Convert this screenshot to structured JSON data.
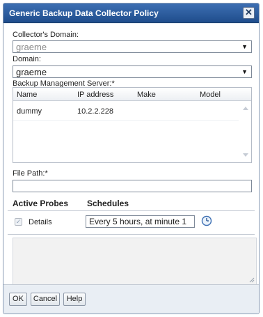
{
  "dialog": {
    "title": "Generic Backup Data Collector Policy",
    "close_symbol": "✕"
  },
  "form": {
    "collectors_domain_label": "Collector's Domain:",
    "collectors_domain_value": "graeme",
    "domain_label": "Domain:",
    "domain_value": "graeme",
    "backup_server_label": "Backup Management Server:*",
    "file_path_label": "File Path:*",
    "file_path_value": ""
  },
  "servers_table": {
    "columns": [
      "Name",
      "IP address",
      "Make",
      "Model"
    ],
    "rows": [
      {
        "name": "dummy",
        "ip": "10.2.2.228",
        "make": "",
        "model": ""
      }
    ]
  },
  "probes": {
    "active_probes_label": "Active Probes",
    "schedules_label": "Schedules",
    "items": [
      {
        "label": "Details",
        "checked": true,
        "schedule": "Every 5 hours, at minute 1"
      }
    ]
  },
  "buttons": {
    "ok": "OK",
    "cancel": "Cancel",
    "help": "Help"
  },
  "icons": {
    "dropdown": "chevron-down-icon",
    "clock": "clock-icon",
    "close": "close-icon"
  },
  "colors": {
    "title_bar": "#2a5a9c",
    "accent": "#3d6fb3"
  }
}
